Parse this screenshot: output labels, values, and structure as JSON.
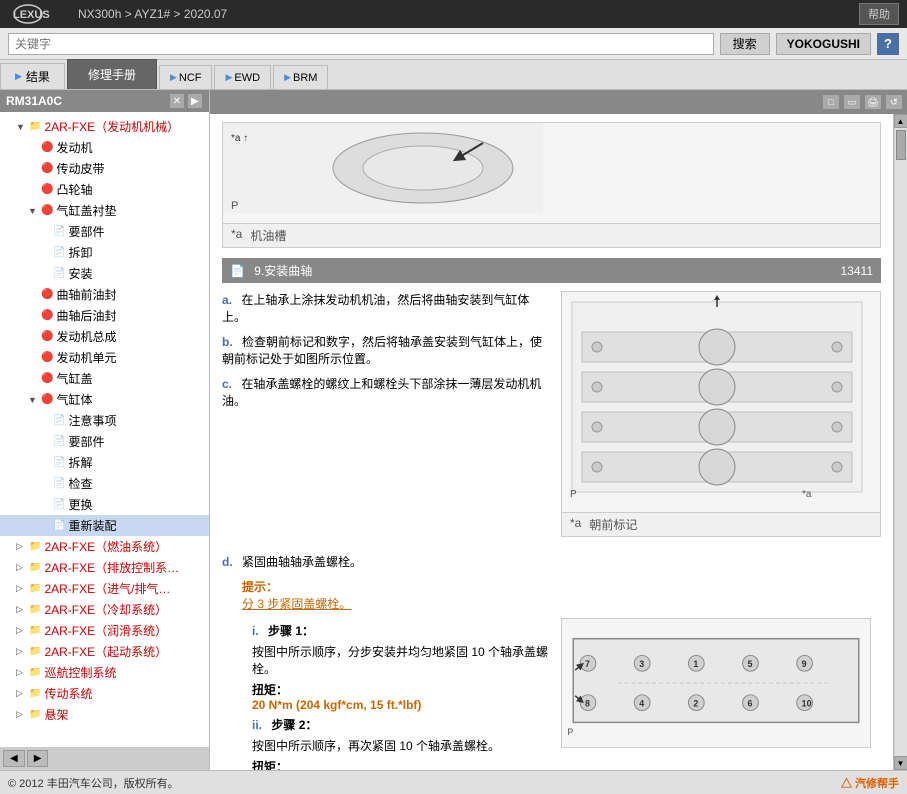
{
  "topbar": {
    "vehicle_info": "NX300h > AYZ1# > 2020.07",
    "help_label": "帮助"
  },
  "searchbar": {
    "placeholder": "关键字",
    "search_label": "搜索",
    "yokogushi_label": "YOKOGUSHI",
    "help_symbol": "?"
  },
  "tabs": {
    "results_label": "结果",
    "repair_manual_label": "修理手册",
    "ncf_label": "NCF",
    "ewd_label": "EWD",
    "brm_label": "BRM"
  },
  "left_panel": {
    "title": "RM31A0C",
    "tree": [
      {
        "id": "t1",
        "label": "2AR-FXE（发动机机械）",
        "indent": 1,
        "type": "folder",
        "toggle": "▼",
        "highlight": true
      },
      {
        "id": "t2",
        "label": "发动机",
        "indent": 2,
        "type": "doc"
      },
      {
        "id": "t3",
        "label": "传动皮带",
        "indent": 2,
        "type": "doc"
      },
      {
        "id": "t4",
        "label": "凸轮轴",
        "indent": 2,
        "type": "doc"
      },
      {
        "id": "t5",
        "label": "气缸盖衬垫",
        "indent": 2,
        "type": "folder",
        "toggle": "▼"
      },
      {
        "id": "t6",
        "label": "要部件",
        "indent": 3,
        "type": "doc"
      },
      {
        "id": "t7",
        "label": "拆卸",
        "indent": 3,
        "type": "doc"
      },
      {
        "id": "t8",
        "label": "安装",
        "indent": 3,
        "type": "doc"
      },
      {
        "id": "t9",
        "label": "曲轴前油封",
        "indent": 2,
        "type": "doc"
      },
      {
        "id": "t10",
        "label": "曲轴后油封",
        "indent": 2,
        "type": "doc"
      },
      {
        "id": "t11",
        "label": "发动机总成",
        "indent": 2,
        "type": "doc"
      },
      {
        "id": "t12",
        "label": "发动机单元",
        "indent": 2,
        "type": "doc"
      },
      {
        "id": "t13",
        "label": "气缸盖",
        "indent": 2,
        "type": "doc"
      },
      {
        "id": "t14",
        "label": "气缸体",
        "indent": 2,
        "type": "folder",
        "toggle": "▼"
      },
      {
        "id": "t15",
        "label": "注意事项",
        "indent": 3,
        "type": "doc"
      },
      {
        "id": "t16",
        "label": "要部件",
        "indent": 3,
        "type": "doc"
      },
      {
        "id": "t17",
        "label": "拆解",
        "indent": 3,
        "type": "doc"
      },
      {
        "id": "t18",
        "label": "检查",
        "indent": 3,
        "type": "doc"
      },
      {
        "id": "t19",
        "label": "更换",
        "indent": 3,
        "type": "doc"
      },
      {
        "id": "t20",
        "label": "重新装配",
        "indent": 3,
        "type": "doc",
        "selected": true
      },
      {
        "id": "t21",
        "label": "2AR-FXE（燃油系统）",
        "indent": 1,
        "type": "folder",
        "toggle": "▷",
        "highlight": true
      },
      {
        "id": "t22",
        "label": "2AR-FXE（排放控制系…",
        "indent": 1,
        "type": "folder",
        "toggle": "▷",
        "highlight": true
      },
      {
        "id": "t23",
        "label": "2AR-FXE（进气/排气…",
        "indent": 1,
        "type": "folder",
        "toggle": "▷",
        "highlight": true
      },
      {
        "id": "t24",
        "label": "2AR-FXE（冷却系统）",
        "indent": 1,
        "type": "folder",
        "toggle": "▷",
        "highlight": true
      },
      {
        "id": "t25",
        "label": "2AR-FXE（润滑系统）",
        "indent": 1,
        "type": "folder",
        "toggle": "▷",
        "highlight": true
      },
      {
        "id": "t26",
        "label": "2AR-FXE（起动系统）",
        "indent": 1,
        "type": "folder",
        "toggle": "▷",
        "highlight": true
      },
      {
        "id": "t27",
        "label": "巡航控制系统",
        "indent": 1,
        "type": "folder",
        "toggle": "▷",
        "highlight": true
      },
      {
        "id": "t28",
        "label": "传动系统",
        "indent": 1,
        "type": "folder",
        "toggle": "▷",
        "highlight": true
      },
      {
        "id": "t29",
        "label": "悬架",
        "indent": 1,
        "type": "folder",
        "toggle": "▷",
        "highlight": true
      }
    ]
  },
  "content": {
    "section_title": "9.安装曲轴",
    "section_id": "13411",
    "top_image_label_a": "*a",
    "top_image_label_text": "机油槽",
    "steps": {
      "a": "在上轴承上涂抹发动机机油，然后将曲轴安装到气缸体上。",
      "b": "检查朝前标记和数字，然后将轴承盖安装到气缸体上，使朝前标记处于如图所示位置。",
      "c": "在轴承盖螺栓的螺纹上和螺栓头下部涂抹一薄层发动机机油。",
      "d": "紧固曲轴轴承盖螺栓。",
      "hint_title": "提示：",
      "hint_link": "分 3 步紧固盖螺栓。",
      "substep_i_label": "i.",
      "substep_i_title": "步骤 1：",
      "substep_i_text": "按图中所示顺序，分步安装并均匀地紧固 10 个轴承盖螺栓。",
      "substep_i_torque_label": "扭矩：",
      "substep_i_torque": "20 N*m (204 kgf*cm, 15 ft.*lbf)",
      "substep_ii_label": "ii.",
      "substep_ii_title": "步骤 2：",
      "substep_ii_text": "按图中所示顺序，再次紧固 10 个轴承盖螺栓。",
      "substep_ii_torque_label": "扭矩："
    },
    "bottom_image_label_a": "*a",
    "bottom_image_label_text": "朝前标记",
    "colors": {
      "accent": "#cc6600",
      "link": "#4a6fa5"
    }
  },
  "footer": {
    "copyright": "© 2012 丰田汽车公司，版权所有。",
    "logo": "汽修帮手"
  }
}
